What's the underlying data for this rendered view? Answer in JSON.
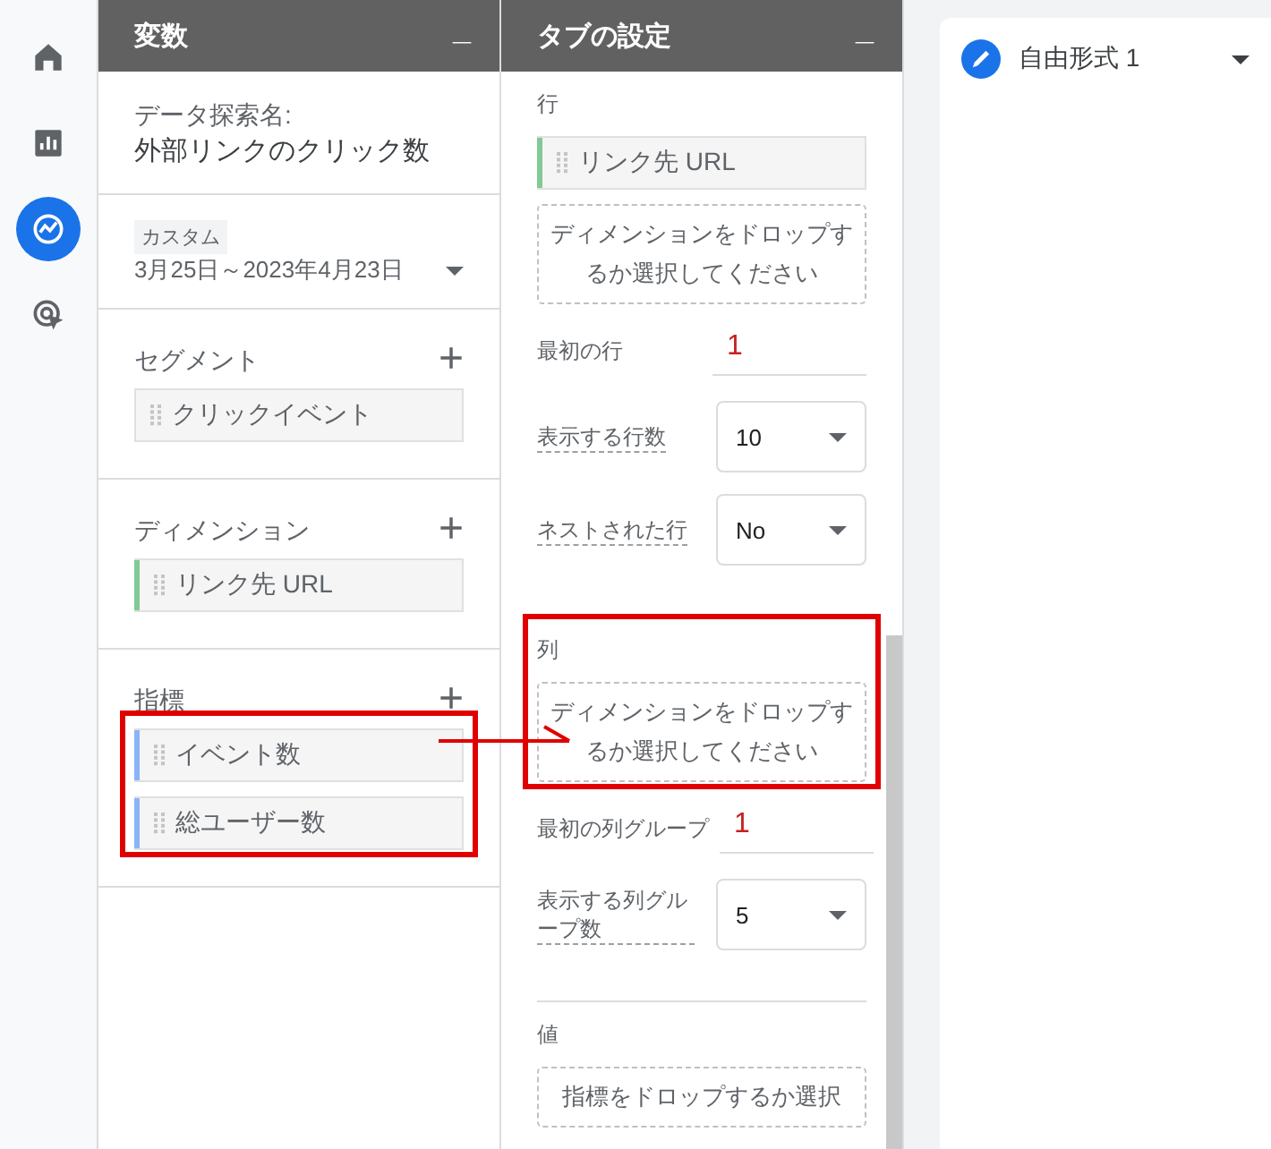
{
  "nav": [
    {
      "selected": false
    },
    {
      "selected": false
    },
    {
      "selected": true
    },
    {
      "selected": false
    }
  ],
  "variables": {
    "title": "変数",
    "collapse": "_",
    "exploration_label": "データ探索名:",
    "exploration_name": "外部リンクのクリック数",
    "date_tag": "カスタム",
    "date_range": "3月25日～2023年4月23日",
    "groups": [
      {
        "kind": "segments",
        "label": "セグメント",
        "add": "+",
        "chips": [
          {
            "text": "クリックイベント"
          }
        ]
      },
      {
        "kind": "dimensions",
        "label": "ディメンション",
        "add": "+",
        "chips": [
          {
            "text": "リンク先 URL",
            "color": "#81c995"
          }
        ]
      },
      {
        "kind": "metrics",
        "label": "指標",
        "add": "+",
        "chips": [
          {
            "text": "イベント数",
            "color": "#8ab4f8"
          },
          {
            "text": "総ユーザー数",
            "color": "#8ab4f8"
          }
        ]
      }
    ]
  },
  "tab_settings": {
    "title": "タブの設定",
    "collapse": "_",
    "sections": [
      {
        "kind": "rows",
        "label": "行",
        "items": [
          {
            "kind": "chip",
            "text": "リンク先 URL",
            "color": "#81c995"
          },
          {
            "kind": "dropzone",
            "text": "ディメンションをドロップするか選択してください"
          },
          {
            "kind": "number",
            "label": "最初の行",
            "value": "1"
          },
          {
            "kind": "select",
            "label": "表示する行数",
            "value": "10"
          },
          {
            "kind": "select",
            "label": "ネストされた行",
            "value": "No"
          }
        ]
      },
      {
        "kind": "columns",
        "label": "列",
        "items": [
          {
            "kind": "dropzone",
            "text": "ディメンションをドロップするか選択してください"
          },
          {
            "kind": "number",
            "label": "最初の列グループ",
            "value": "1"
          },
          {
            "kind": "select",
            "label": "表示する列グループ数",
            "value": "5"
          }
        ]
      },
      {
        "kind": "values",
        "label": "値",
        "items": [
          {
            "kind": "dropzone",
            "text": "指標をドロップするか選択"
          }
        ]
      }
    ]
  },
  "canvas": {
    "tab_name": "自由形式 1"
  },
  "annotations": [
    {
      "kind": "box"
    },
    {
      "kind": "box"
    },
    {
      "kind": "arrow"
    }
  ]
}
